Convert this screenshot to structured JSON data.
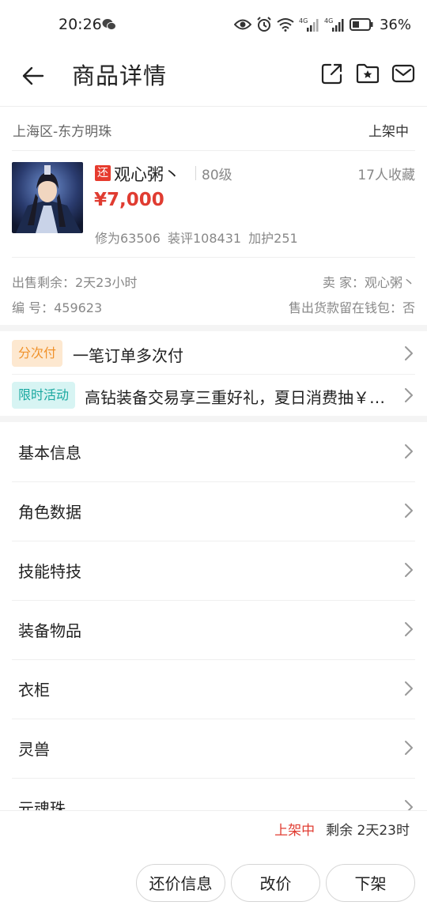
{
  "status_bar": {
    "time": "20:26",
    "battery": "36%",
    "icons": [
      "wechat-icon",
      "eye-icon",
      "alarm-icon",
      "wifi-icon",
      "signal-4g-icon",
      "signal-4g-icon",
      "battery-icon"
    ]
  },
  "header": {
    "title": "商品详情",
    "icons": [
      "back-arrow-icon",
      "share-external-icon",
      "favorite-folder-icon",
      "mail-icon"
    ]
  },
  "server": {
    "name": "上海区-东方明珠",
    "status": "上架中"
  },
  "product": {
    "tag": "还",
    "name": "观心粥丶",
    "level": "80级",
    "favorites": "17人收藏",
    "price": "¥7,000",
    "stats": "修为63506 装评108431 加护251"
  },
  "meta": {
    "remaining_sale": "出售剩余：2天23小时",
    "seller": "卖  家：观心粥丶",
    "number": "编  号：459623",
    "wallet": "售出货款留在钱包：否"
  },
  "promos": [
    {
      "tag": "分次付",
      "text": "一笔订单多次付"
    },
    {
      "tag": "限时活动",
      "text": "高钻装备交易享三重好礼，夏日消费抽￥…"
    }
  ],
  "menu": [
    {
      "label": "基本信息"
    },
    {
      "label": "角色数据"
    },
    {
      "label": "技能特技"
    },
    {
      "label": "装备物品"
    },
    {
      "label": "衣柜"
    },
    {
      "label": "灵兽"
    },
    {
      "label": "元魂珠"
    }
  ],
  "bottom": {
    "status": "上架中",
    "remaining": "剩余 2天23时",
    "buttons": [
      "还价信息",
      "改价",
      "下架"
    ]
  },
  "colors": {
    "accent_red": "#e03c31",
    "tag_orange_bg": "#fde8d0",
    "tag_orange_text": "#f0922b",
    "tag_teal_bg": "#d7f4f3",
    "tag_teal_text": "#1aa8a0"
  }
}
